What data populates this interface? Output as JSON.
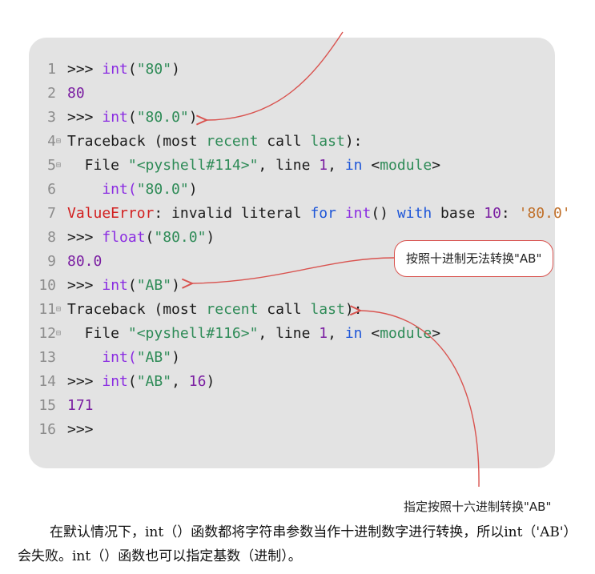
{
  "code_lines": [
    {
      "ln": "1",
      "fold": "",
      "tokens": [
        {
          "t": ">>> ",
          "c": "tok-prompt"
        },
        {
          "t": "int",
          "c": "tok-builtin"
        },
        {
          "t": "(",
          "c": "tok-plain"
        },
        {
          "t": "\"80\"",
          "c": "tok-str"
        },
        {
          "t": ")",
          "c": "tok-plain"
        }
      ]
    },
    {
      "ln": "2",
      "fold": "",
      "tokens": [
        {
          "t": "80",
          "c": "tok-num"
        }
      ]
    },
    {
      "ln": "3",
      "fold": "",
      "tokens": [
        {
          "t": ">>> ",
          "c": "tok-prompt"
        },
        {
          "t": "int",
          "c": "tok-builtin"
        },
        {
          "t": "(",
          "c": "tok-plain"
        },
        {
          "t": "\"80.0\"",
          "c": "tok-str"
        },
        {
          "t": ")",
          "c": "tok-plain"
        }
      ]
    },
    {
      "ln": "4",
      "fold": "⊟",
      "tokens": [
        {
          "t": "Traceback (most ",
          "c": "tok-plain"
        },
        {
          "t": "recent",
          "c": "tok-str"
        },
        {
          "t": " call ",
          "c": "tok-plain"
        },
        {
          "t": "last",
          "c": "tok-str"
        },
        {
          "t": "):",
          "c": "tok-plain"
        }
      ]
    },
    {
      "ln": "5",
      "fold": "⊟",
      "tokens": [
        {
          "t": "  File ",
          "c": "tok-plain"
        },
        {
          "t": "\"<pyshell#114>\"",
          "c": "tok-str"
        },
        {
          "t": ", line ",
          "c": "tok-plain"
        },
        {
          "t": "1",
          "c": "tok-num"
        },
        {
          "t": ", ",
          "c": "tok-plain"
        },
        {
          "t": "in",
          "c": "tok-kw"
        },
        {
          "t": " <",
          "c": "tok-plain"
        },
        {
          "t": "module",
          "c": "tok-str"
        },
        {
          "t": ">",
          "c": "tok-plain"
        }
      ]
    },
    {
      "ln": "6",
      "fold": "",
      "tokens": [
        {
          "t": "    int(",
          "c": "tok-builtin"
        },
        {
          "t": "\"80.0\"",
          "c": "tok-str"
        },
        {
          "t": ")",
          "c": "tok-plain"
        }
      ]
    },
    {
      "ln": "7",
      "fold": "",
      "tokens": [
        {
          "t": "ValueError",
          "c": "tok-err"
        },
        {
          "t": ": invalid literal ",
          "c": "tok-plain"
        },
        {
          "t": "for",
          "c": "tok-kw"
        },
        {
          "t": " ",
          "c": "tok-plain"
        },
        {
          "t": "int",
          "c": "tok-builtin"
        },
        {
          "t": "() ",
          "c": "tok-plain"
        },
        {
          "t": "with",
          "c": "tok-kw"
        },
        {
          "t": " base ",
          "c": "tok-plain"
        },
        {
          "t": "10",
          "c": "tok-num"
        },
        {
          "t": ": ",
          "c": "tok-plain"
        },
        {
          "t": "'80.0'",
          "c": "tok-orange"
        }
      ]
    },
    {
      "ln": "8",
      "fold": "",
      "tokens": [
        {
          "t": ">>> ",
          "c": "tok-prompt"
        },
        {
          "t": "float",
          "c": "tok-builtin"
        },
        {
          "t": "(",
          "c": "tok-plain"
        },
        {
          "t": "\"80.0\"",
          "c": "tok-str"
        },
        {
          "t": ")",
          "c": "tok-plain"
        }
      ]
    },
    {
      "ln": "9",
      "fold": "",
      "tokens": [
        {
          "t": "80.0",
          "c": "tok-num"
        }
      ]
    },
    {
      "ln": "10",
      "fold": "",
      "tokens": [
        {
          "t": ">>> ",
          "c": "tok-prompt"
        },
        {
          "t": "int",
          "c": "tok-builtin"
        },
        {
          "t": "(",
          "c": "tok-plain"
        },
        {
          "t": "\"AB\"",
          "c": "tok-str"
        },
        {
          "t": ")",
          "c": "tok-plain"
        }
      ]
    },
    {
      "ln": "11",
      "fold": "⊟",
      "tokens": [
        {
          "t": "Traceback (most ",
          "c": "tok-plain"
        },
        {
          "t": "recent",
          "c": "tok-str"
        },
        {
          "t": " call ",
          "c": "tok-plain"
        },
        {
          "t": "last",
          "c": "tok-str"
        },
        {
          "t": "):",
          "c": "tok-plain"
        }
      ]
    },
    {
      "ln": "12",
      "fold": "⊟",
      "tokens": [
        {
          "t": "  File ",
          "c": "tok-plain"
        },
        {
          "t": "\"<pyshell#116>\"",
          "c": "tok-str"
        },
        {
          "t": ", line ",
          "c": "tok-plain"
        },
        {
          "t": "1",
          "c": "tok-num"
        },
        {
          "t": ", ",
          "c": "tok-plain"
        },
        {
          "t": "in",
          "c": "tok-kw"
        },
        {
          "t": " <",
          "c": "tok-plain"
        },
        {
          "t": "module",
          "c": "tok-str"
        },
        {
          "t": ">",
          "c": "tok-plain"
        }
      ]
    },
    {
      "ln": "13",
      "fold": "",
      "tokens": [
        {
          "t": "    int(",
          "c": "tok-builtin"
        },
        {
          "t": "\"AB\"",
          "c": "tok-str"
        },
        {
          "t": ")",
          "c": "tok-plain"
        }
      ]
    },
    {
      "ln": "14",
      "fold": "",
      "tokens": [
        {
          "t": ">>> ",
          "c": "tok-prompt"
        },
        {
          "t": "int",
          "c": "tok-builtin"
        },
        {
          "t": "(",
          "c": "tok-plain"
        },
        {
          "t": "\"AB\"",
          "c": "tok-str"
        },
        {
          "t": ", ",
          "c": "tok-plain"
        },
        {
          "t": "16",
          "c": "tok-num"
        },
        {
          "t": ")",
          "c": "tok-plain"
        }
      ]
    },
    {
      "ln": "15",
      "fold": "",
      "tokens": [
        {
          "t": "171",
          "c": "tok-num"
        }
      ]
    },
    {
      "ln": "16",
      "fold": "",
      "tokens": [
        {
          "t": ">>> ",
          "c": "tok-prompt"
        }
      ]
    }
  ],
  "callouts": {
    "decimal_fail": "按照十进制无法转换\"AB\"",
    "hex_convert": "指定按照十六进制转换\"AB\""
  },
  "paragraph": "在默认情况下，int（）函数都将字符串参数当作十进制数字进行转换，所以int（'AB'）会失败。int（）函数也可以指定基数（进制）。",
  "colors": {
    "panel_bg": "#e3e3e3",
    "arrow": "#d9534f"
  }
}
